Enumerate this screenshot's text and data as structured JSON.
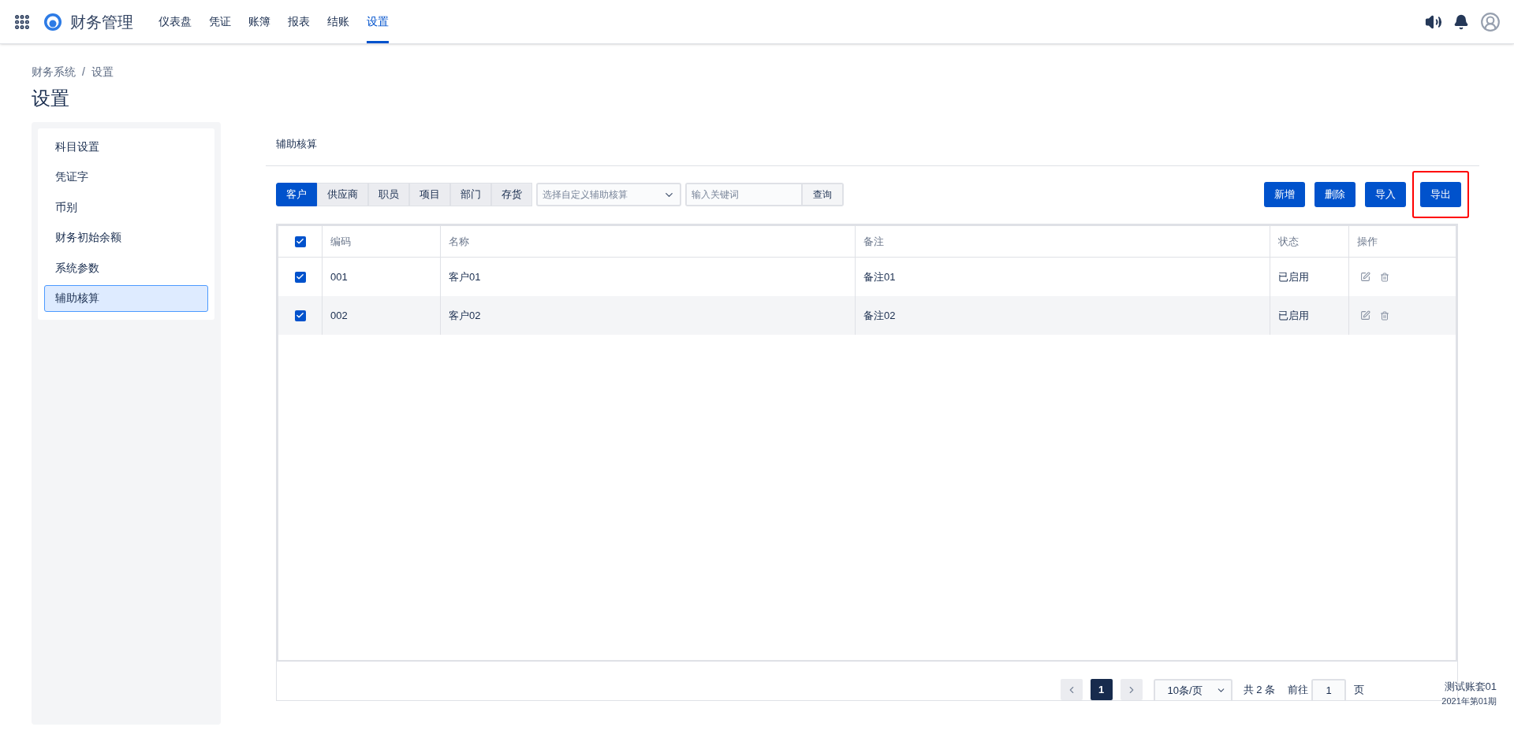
{
  "app": {
    "title": "财务管理"
  },
  "nav": [
    {
      "label": "仪表盘",
      "selected": false
    },
    {
      "label": "凭证",
      "selected": false
    },
    {
      "label": "账簿",
      "selected": false
    },
    {
      "label": "报表",
      "selected": false
    },
    {
      "label": "结账",
      "selected": false
    },
    {
      "label": "设置",
      "selected": true
    }
  ],
  "breadcrumb": {
    "items": [
      "财务系统",
      "设置"
    ],
    "separator": "/"
  },
  "page_title": "设置",
  "sidebar": {
    "items": [
      {
        "label": "科目设置",
        "selected": false
      },
      {
        "label": "凭证字",
        "selected": false
      },
      {
        "label": "币别",
        "selected": false
      },
      {
        "label": "财务初始余额",
        "selected": false
      },
      {
        "label": "系统参数",
        "selected": false
      },
      {
        "label": "辅助核算",
        "selected": true
      }
    ]
  },
  "section_title": "辅助核算",
  "category_tabs": [
    {
      "label": "客户",
      "selected": true
    },
    {
      "label": "供应商",
      "selected": false
    },
    {
      "label": "职员",
      "selected": false
    },
    {
      "label": "项目",
      "selected": false
    },
    {
      "label": "部门",
      "selected": false
    },
    {
      "label": "存货",
      "selected": false
    }
  ],
  "custom_select": {
    "placeholder": "选择自定义辅助核算"
  },
  "keyword_search": {
    "placeholder": "输入关键词",
    "button": "查询"
  },
  "actions": [
    {
      "label": "新增",
      "highlighted": false
    },
    {
      "label": "删除",
      "highlighted": false
    },
    {
      "label": "导入",
      "highlighted": false
    },
    {
      "label": "导出",
      "highlighted": true
    }
  ],
  "table": {
    "all_checked": true,
    "columns": [
      "编码",
      "名称",
      "备注",
      "状态",
      "操作"
    ],
    "rows": [
      {
        "checked": true,
        "cells": [
          "001",
          "客户01",
          "备注01",
          "已启用"
        ]
      },
      {
        "checked": true,
        "cells": [
          "002",
          "客户02",
          "备注02",
          "已启用"
        ]
      }
    ]
  },
  "pagination": {
    "pages": [
      {
        "label": "1",
        "selected": true
      }
    ],
    "page_size": "10条/页",
    "total": "共 2 条",
    "goto_label": "前往",
    "goto_value": "1",
    "goto_suffix": "页"
  },
  "account_info": [
    "测试账套01",
    "2021年第01期"
  ]
}
